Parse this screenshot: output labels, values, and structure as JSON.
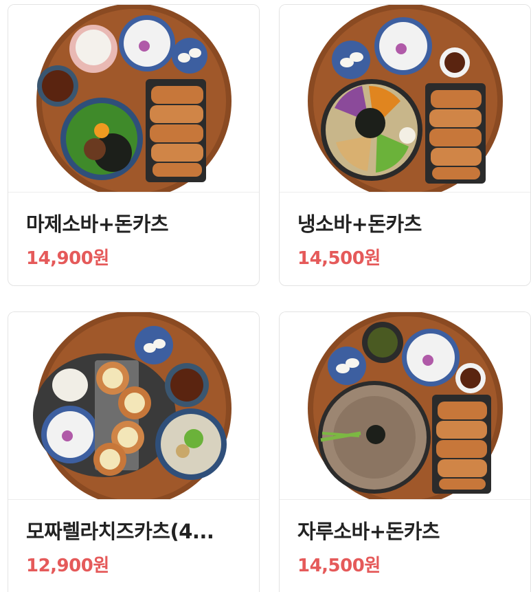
{
  "menu": {
    "items": [
      {
        "name": "마제소바+돈카츠",
        "price": "14,900원",
        "photo": "mazesoba-tonkatsu-set-photo"
      },
      {
        "name": "냉소바+돈카츠",
        "price": "14,500원",
        "photo": "cold-soba-tonkatsu-set-photo"
      },
      {
        "name": "모짜렐라치즈카츠(4...",
        "price": "12,900원",
        "photo": "mozzarella-cheese-katsu-set-photo"
      },
      {
        "name": "자루소바+돈카츠",
        "price": "14,500원",
        "photo": "zaru-soba-tonkatsu-set-photo"
      }
    ]
  },
  "colors": {
    "price": "#e55a5a",
    "name": "#222222",
    "tray": "#8a4a22",
    "card_border": "#e3e3e3"
  }
}
